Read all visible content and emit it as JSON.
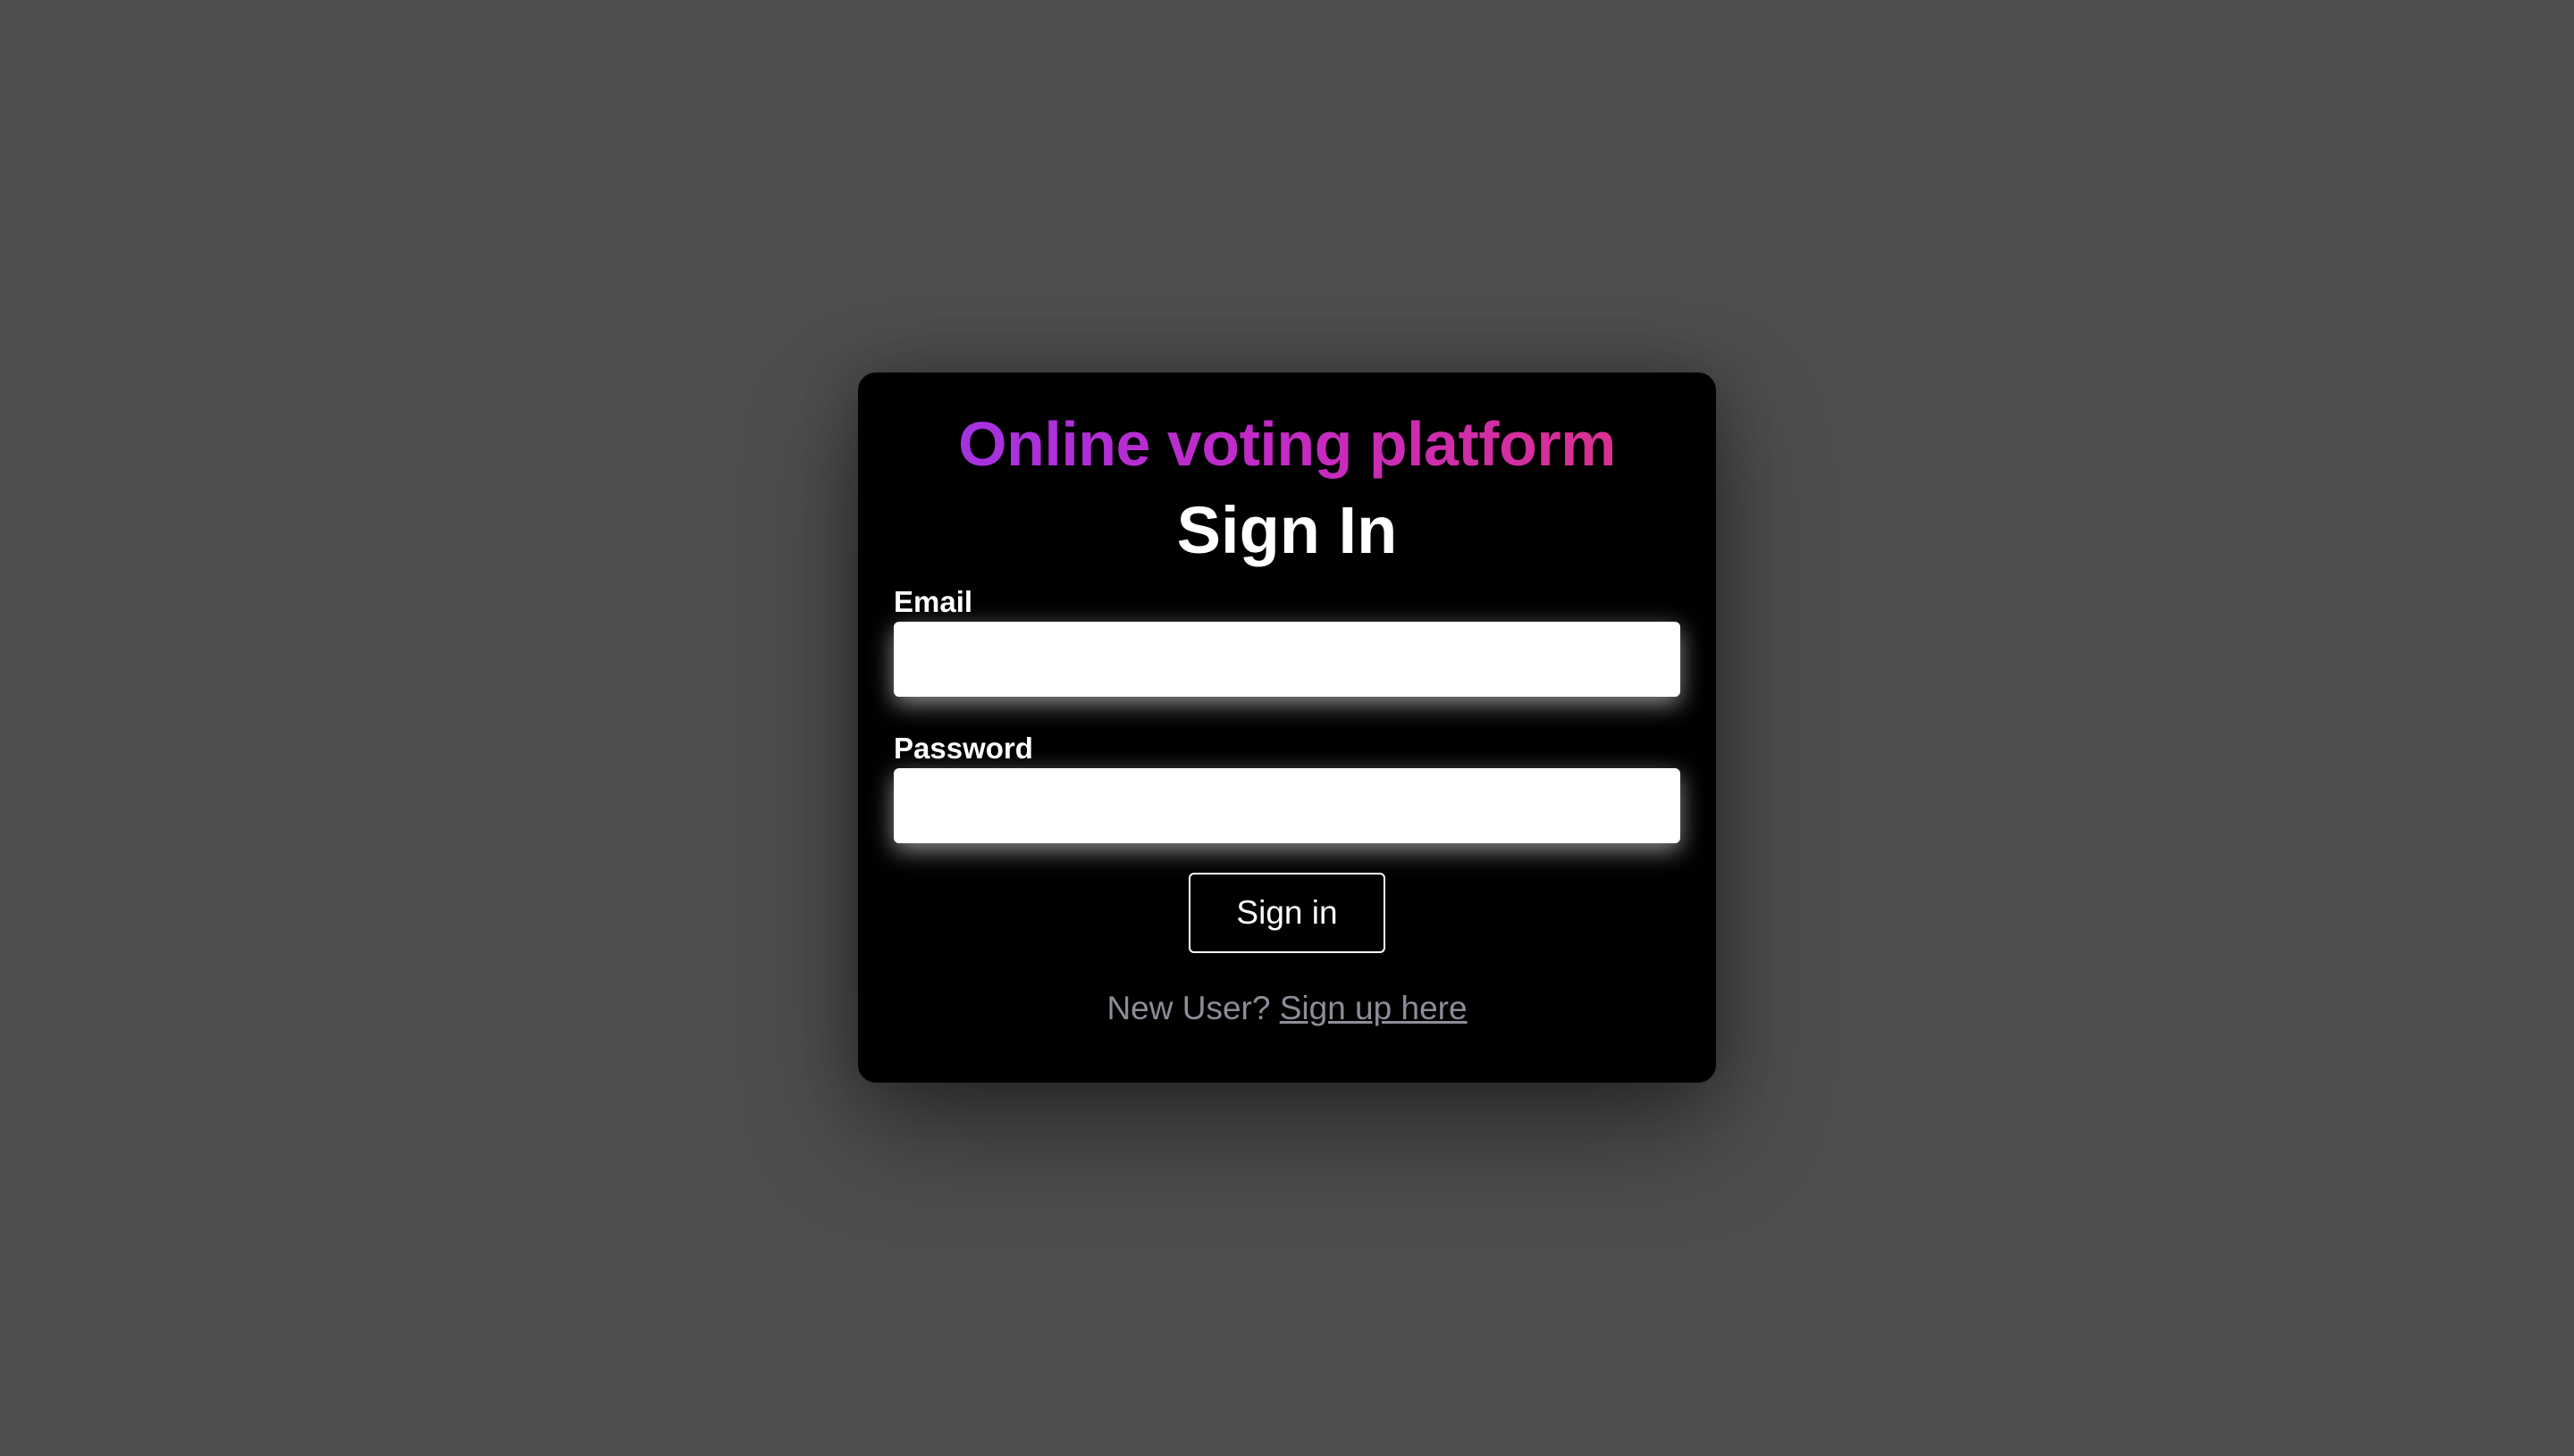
{
  "app": {
    "title": "Online voting platform"
  },
  "form": {
    "heading": "Sign In",
    "email": {
      "label": "Email",
      "value": "",
      "placeholder": ""
    },
    "password": {
      "label": "Password",
      "value": "",
      "placeholder": ""
    },
    "submit_label": "Sign in"
  },
  "signup": {
    "prompt": "New User?",
    "link_label": "Sign up here"
  },
  "colors": {
    "background": "#4e4e4e",
    "card": "#000000",
    "title_gradient_start": "#9a35e8",
    "title_gradient_end": "#e23280",
    "link": "#8d8d99"
  }
}
